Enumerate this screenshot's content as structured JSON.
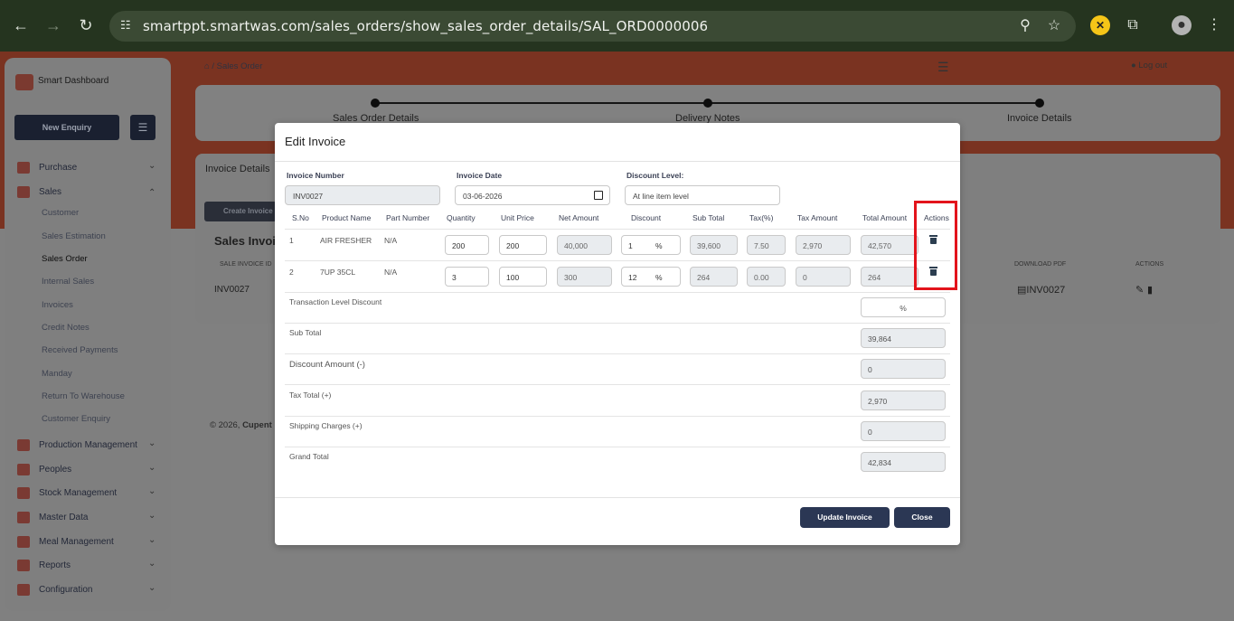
{
  "browser": {
    "url": "smartppt.smartwas.com/sales_orders/show_sales_order_details/SAL_ORD0000006"
  },
  "sidebar": {
    "brand": "Smart Dashboard",
    "new_enquiry": "New Enquiry",
    "items": [
      {
        "label": "Purchase",
        "expanded": false
      },
      {
        "label": "Sales",
        "expanded": true
      },
      {
        "label": "Production Management",
        "expanded": false
      },
      {
        "label": "Peoples",
        "expanded": false
      },
      {
        "label": "Stock Management",
        "expanded": false
      },
      {
        "label": "Master Data",
        "expanded": false
      },
      {
        "label": "Meal Management",
        "expanded": false
      },
      {
        "label": "Reports",
        "expanded": false
      },
      {
        "label": "Configuration",
        "expanded": false
      }
    ],
    "sales_sub": [
      "Customer",
      "Sales Estimation",
      "Sales Order",
      "Internal Sales",
      "Invoices",
      "Credit Notes",
      "Received Payments",
      "Manday",
      "Return To Warehouse",
      "Customer Enquiry"
    ],
    "active_sub": "Sales Order"
  },
  "header": {
    "breadcrumb": "Sales Order",
    "logout": "Log out"
  },
  "steps": [
    "Sales Order Details",
    "Delivery Notes",
    "Invoice Details"
  ],
  "background": {
    "card_title": "Invoice Details",
    "create_invoice": "Create Invoice",
    "section_title": "Sales Invoi",
    "col_sale_invoice_id": "SALE INVOICE ID",
    "col_download_pdf": "DOWNLOAD PDF",
    "col_actions": "ACTIONS",
    "row_invoice_id": "INV0027",
    "row_pdf": "INV0027",
    "footer_year": "© 2026,",
    "footer_company": "Cupent"
  },
  "modal": {
    "title": "Edit Invoice",
    "invoice_number_label": "Invoice Number",
    "invoice_number": "INV0027",
    "invoice_date_label": "Invoice Date",
    "invoice_date": "03-06-2026",
    "discount_level_label": "Discount Level:",
    "discount_level": "At line item level",
    "columns": [
      "S.No",
      "Product Name",
      "Part Number",
      "Quantity",
      "Unit Price",
      "Net Amount",
      "Discount",
      "Sub Total",
      "Tax(%)",
      "Tax Amount",
      "Total Amount",
      "Actions"
    ],
    "rows": [
      {
        "sno": "1",
        "product": "AIR FRESHER",
        "part": "N/A",
        "qty": "200",
        "unit_price": "200",
        "net": "40,000",
        "discount": "1",
        "discount_unit": "%",
        "sub_total": "39,600",
        "tax_pct": "7.50",
        "tax_amount": "2,970",
        "total": "42,570"
      },
      {
        "sno": "2",
        "product": "7UP 35CL",
        "part": "N/A",
        "qty": "3",
        "unit_price": "100",
        "net": "300",
        "discount": "12",
        "discount_unit": "%",
        "sub_total": "264",
        "tax_pct": "0.00",
        "tax_amount": "0",
        "total": "264"
      }
    ],
    "transaction_discount_label": "Transaction Level Discount",
    "transaction_discount_unit": "%",
    "sub_total_label": "Sub Total",
    "sub_total": "39,864",
    "discount_amount_label": "Discount Amount (-)",
    "discount_amount": "0",
    "tax_total_label": "Tax Total (+)",
    "tax_total": "2,970",
    "shipping_label": "Shipping Charges (+)",
    "shipping": "0",
    "grand_total_label": "Grand Total",
    "grand_total": "42,834",
    "update_button": "Update Invoice",
    "close_button": "Close"
  },
  "colors": {
    "accent": "#2b3754",
    "highlight": "#e3141c",
    "brand_orange": "#f15a29"
  }
}
